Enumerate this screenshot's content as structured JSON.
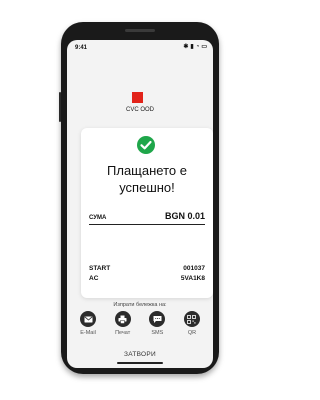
{
  "status_bar": {
    "time": "9:41"
  },
  "merchant": {
    "name": "CVC OOD",
    "logo_color": "#e2231a"
  },
  "result": {
    "icon": "check-circle-icon",
    "color": "#1fa64a",
    "title_line1": "Плащането е",
    "title_line2": "успешно!"
  },
  "amount": {
    "label": "СУМА",
    "value": "BGN 0.01"
  },
  "details": [
    {
      "label": "START",
      "value": "001037"
    },
    {
      "label": "AC",
      "value": "5VA1K8"
    }
  ],
  "receipt": {
    "prompt": "Изпрати бележка на:",
    "options": [
      {
        "label": "E-Mail",
        "icon": "mail-icon"
      },
      {
        "label": "Печат",
        "icon": "printer-icon"
      },
      {
        "label": "SMS",
        "icon": "sms-icon"
      },
      {
        "label": "QR",
        "icon": "qr-code-icon"
      }
    ]
  },
  "close_label": "ЗАТВОРИ"
}
